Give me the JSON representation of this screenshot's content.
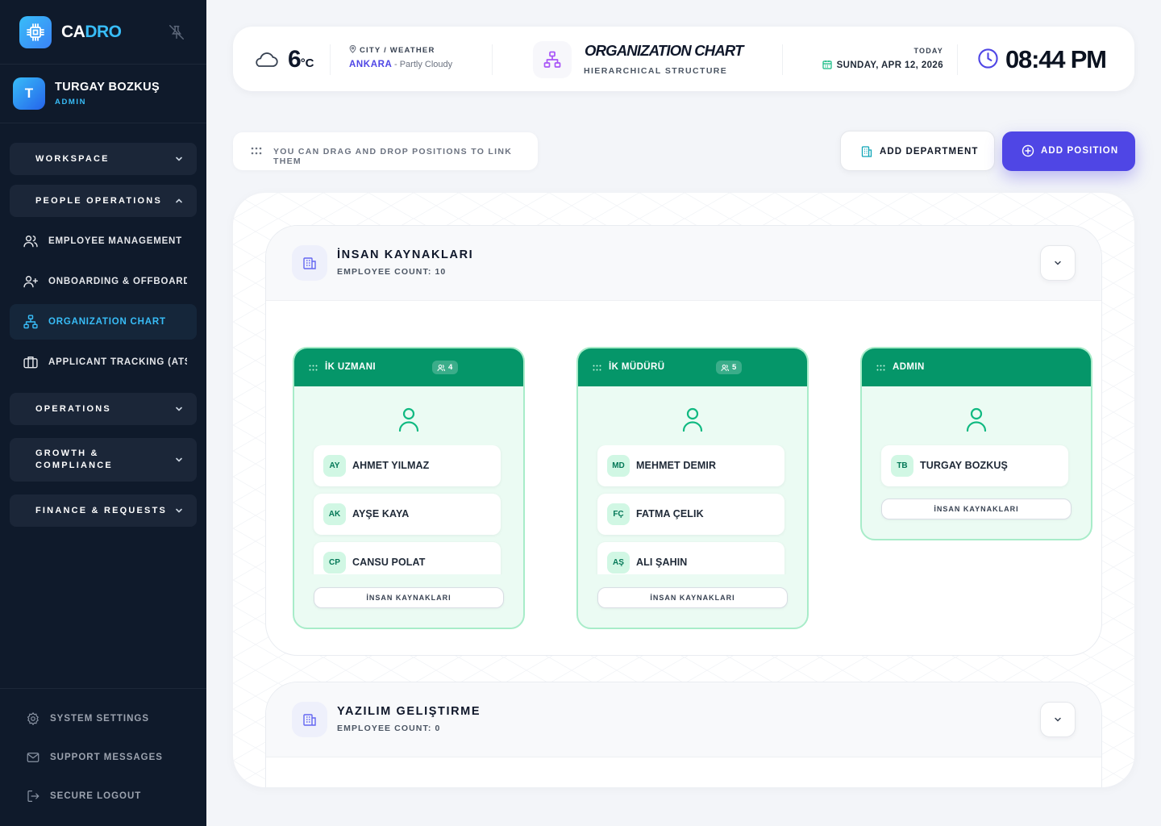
{
  "app": {
    "brand_a": "CA",
    "brand_b": "DRO"
  },
  "user": {
    "initial": "T",
    "name": "TURGAY BOZKUŞ",
    "role": "ADMIN"
  },
  "nav": {
    "workspace": "WORKSPACE",
    "people_operations": "PEOPLE OPERATIONS",
    "items": [
      {
        "label": "EMPLOYEE MANAGEMENT",
        "icon": "users-icon"
      },
      {
        "label": "ONBOARDING & OFFBOARDING",
        "icon": "user-plus-icon"
      },
      {
        "label": "ORGANIZATION CHART",
        "icon": "org-chart-icon",
        "active": true
      },
      {
        "label": "APPLICANT TRACKING (ATS)",
        "icon": "briefcase-icon"
      }
    ],
    "operations": "OPERATIONS",
    "growth_line1": "GROWTH &",
    "growth_line2": "COMPLIANCE",
    "finance": "FINANCE & REQUESTS"
  },
  "footer": {
    "settings": "SYSTEM SETTINGS",
    "support": "SUPPORT MESSAGES",
    "logout": "SECURE LOGOUT"
  },
  "header": {
    "temp_value": "6",
    "temp_unit": "°C",
    "weather_label": "CITY / WEATHER",
    "city": "ANKARA",
    "condition": "- Partly Cloudy",
    "title": "ORGANIZATION CHART",
    "subtitle": "HIERARCHICAL STRUCTURE",
    "today_label": "TODAY",
    "date": "SUNDAY, APR 12, 2026",
    "time": "08:44 PM"
  },
  "actions": {
    "hint": "YOU CAN DRAG AND DROP POSITIONS TO LINK THEM",
    "add_department": "ADD DEPARTMENT",
    "add_position": "ADD POSITION"
  },
  "departments": [
    {
      "name": "İNSAN KAYNAKLARI",
      "count_label": "EMPLOYEE COUNT: 10",
      "positions": [
        {
          "title": "İK UZMANI",
          "badge": "4",
          "employees": [
            {
              "initials": "AY",
              "name": "AHMET YILMAZ"
            },
            {
              "initials": "AK",
              "name": "AYŞE KAYA"
            },
            {
              "initials": "CP",
              "name": "CANSU POLAT"
            }
          ],
          "department_tag": "İNSAN KAYNAKLARI"
        },
        {
          "title": "İK MÜDÜRÜ",
          "badge": "5",
          "employees": [
            {
              "initials": "MD",
              "name": "MEHMET DEMIR"
            },
            {
              "initials": "FÇ",
              "name": "FATMA ÇELIK"
            },
            {
              "initials": "AŞ",
              "name": "ALI ŞAHIN"
            }
          ],
          "department_tag": "İNSAN KAYNAKLARI"
        },
        {
          "title": "ADMIN",
          "employees": [
            {
              "initials": "TB",
              "name": "TURGAY BOZKUŞ"
            }
          ],
          "department_tag": "İNSAN KAYNAKLARI"
        }
      ]
    },
    {
      "name": "YAZILIM GELIŞTIRME",
      "count_label": "EMPLOYEE COUNT: 0",
      "positions": []
    }
  ],
  "colors": {
    "sidebar_bg": "#0f1a2b",
    "accent": "#38bdf8",
    "primary": "#4f46e5",
    "position_header": "#059669",
    "position_bg": "#ebfbf3"
  }
}
